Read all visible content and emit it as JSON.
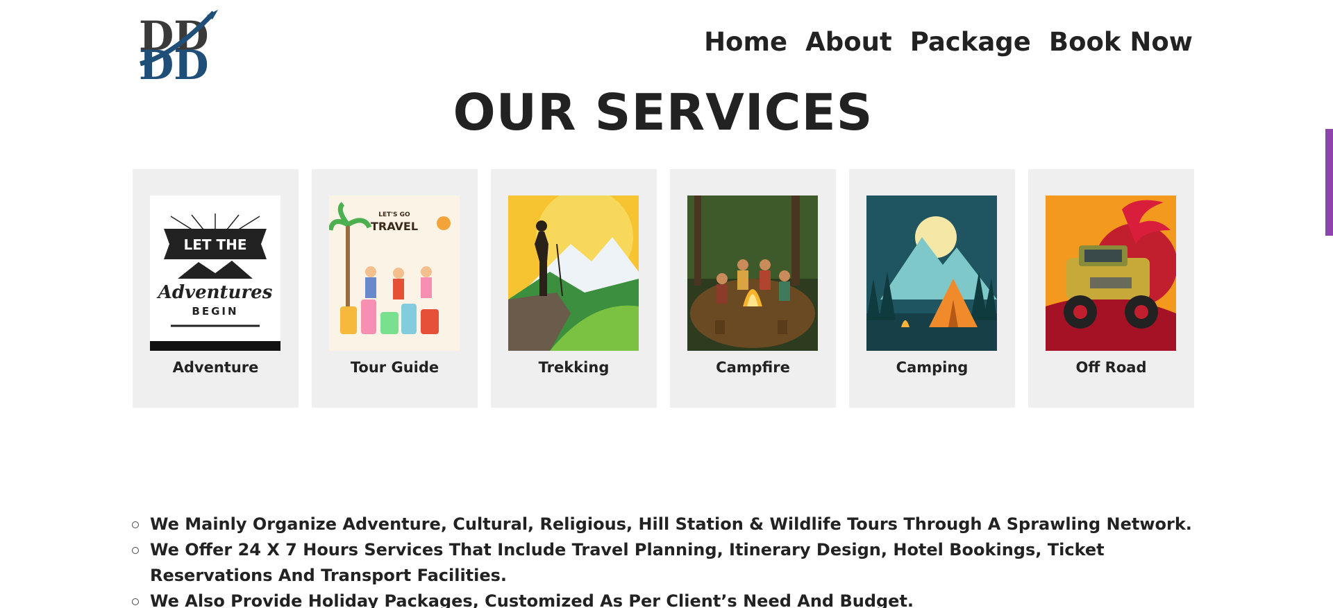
{
  "nav": {
    "items": [
      "Home",
      "About",
      "Package",
      "Book Now"
    ]
  },
  "page": {
    "title": "OUR SERVICES"
  },
  "services": [
    {
      "label": "Adventure",
      "image": "adventure-image"
    },
    {
      "label": "Tour Guide",
      "image": "tour-guide-image"
    },
    {
      "label": "Trekking",
      "image": "trekking-image"
    },
    {
      "label": "Campfire",
      "image": "campfire-image"
    },
    {
      "label": "Camping",
      "image": "camping-image"
    },
    {
      "label": "Off Road",
      "image": "off-road-image"
    }
  ],
  "adventure_art": {
    "line1": "LET THE",
    "line2": "Adventures",
    "line3": "BEGIN"
  },
  "tour_art": {
    "line1": "LET'S GO",
    "line2": "TRAVEL"
  },
  "bullets": [
    "We Mainly Organize Adventure, Cultural, Religious, Hill Station & Wildlife Tours Through A Sprawling Network.",
    "We Offer 24 X 7 Hours Services That Include Travel Planning, Itinerary Design, Hotel Bookings, Ticket Reservations And Transport Facilities.",
    "We Also Provide Holiday Packages, Customized As Per Client’s Need And Budget."
  ],
  "colors": {
    "accent": "#8e44ad",
    "logo": "#1f4e79",
    "card_bg": "#efefef",
    "text": "#222222"
  }
}
